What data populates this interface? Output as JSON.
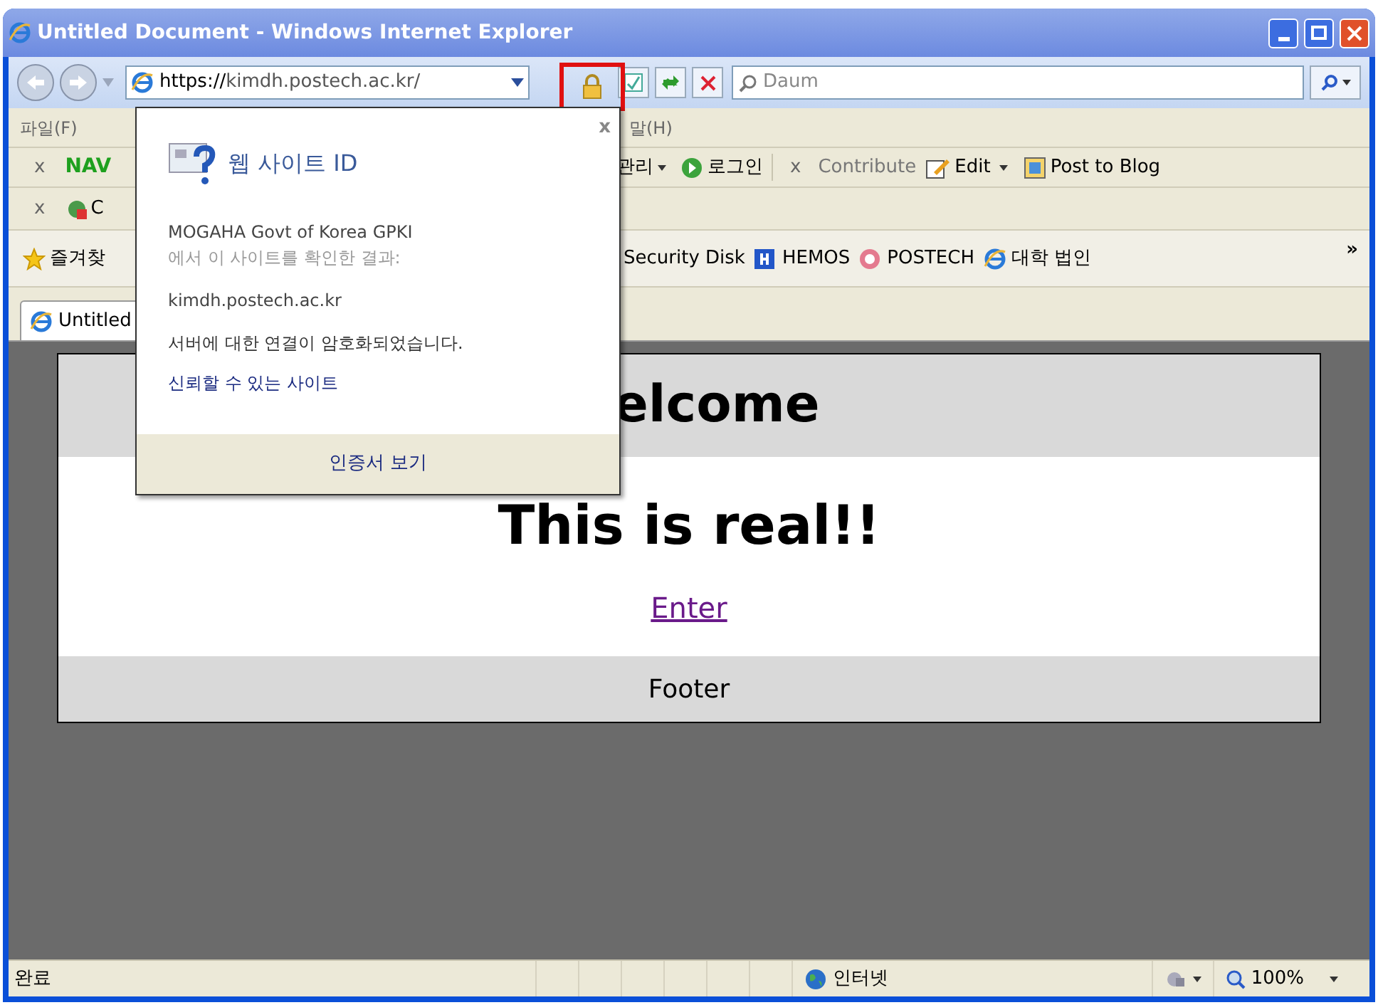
{
  "window": {
    "title": "Untitled Document - Windows Internet Explorer"
  },
  "address_bar": {
    "url_scheme": "https://",
    "url_host": "kimdh.postech.ac.kr/",
    "search_placeholder": "Daum"
  },
  "menu_bar": {
    "left": "파일(F)",
    "right": "말(H)"
  },
  "toolbar_1": {
    "left_close": "x",
    "left_label": "NAV",
    "items": [
      {
        "kind": "dropdown",
        "label": "관리"
      },
      {
        "kind": "login",
        "label": "로그인"
      },
      {
        "kind": "close",
        "label": "x"
      },
      {
        "kind": "plain",
        "label": "Contribute"
      },
      {
        "kind": "edit",
        "label": "Edit"
      },
      {
        "kind": "post",
        "label": "Post to Blog"
      }
    ]
  },
  "toolbar_2": {
    "left_close": "x",
    "left_label": "C"
  },
  "favorites_bar": {
    "left_label": "즐겨찾",
    "items": [
      {
        "kind": "plain",
        "label": "Security Disk"
      },
      {
        "kind": "hemos",
        "label": "HEMOS"
      },
      {
        "kind": "postech",
        "label": "POSTECH"
      },
      {
        "kind": "ie",
        "label": "대학 법인"
      }
    ],
    "more": "»"
  },
  "tabs": [
    {
      "label": "Untitled",
      "selected": true
    }
  ],
  "page": {
    "header": "elcome",
    "headline": "This is real!!",
    "link": "Enter",
    "footer": "Footer"
  },
  "popup": {
    "close": "x",
    "title": "웹 사이트 ID",
    "issuer": "MOGAHA Govt of Korea GPKI",
    "issuer_note": "에서 이 사이트를 확인한 결과:",
    "host": "kimdh.postech.ac.kr",
    "message": "서버에 대한 연결이 암호화되었습니다.",
    "trust_link": "신뢰할 수 있는 사이트",
    "footer_button": "인증서 보기"
  },
  "status_bar": {
    "text": "완료",
    "zone": "인터넷",
    "zoom": "100%"
  }
}
